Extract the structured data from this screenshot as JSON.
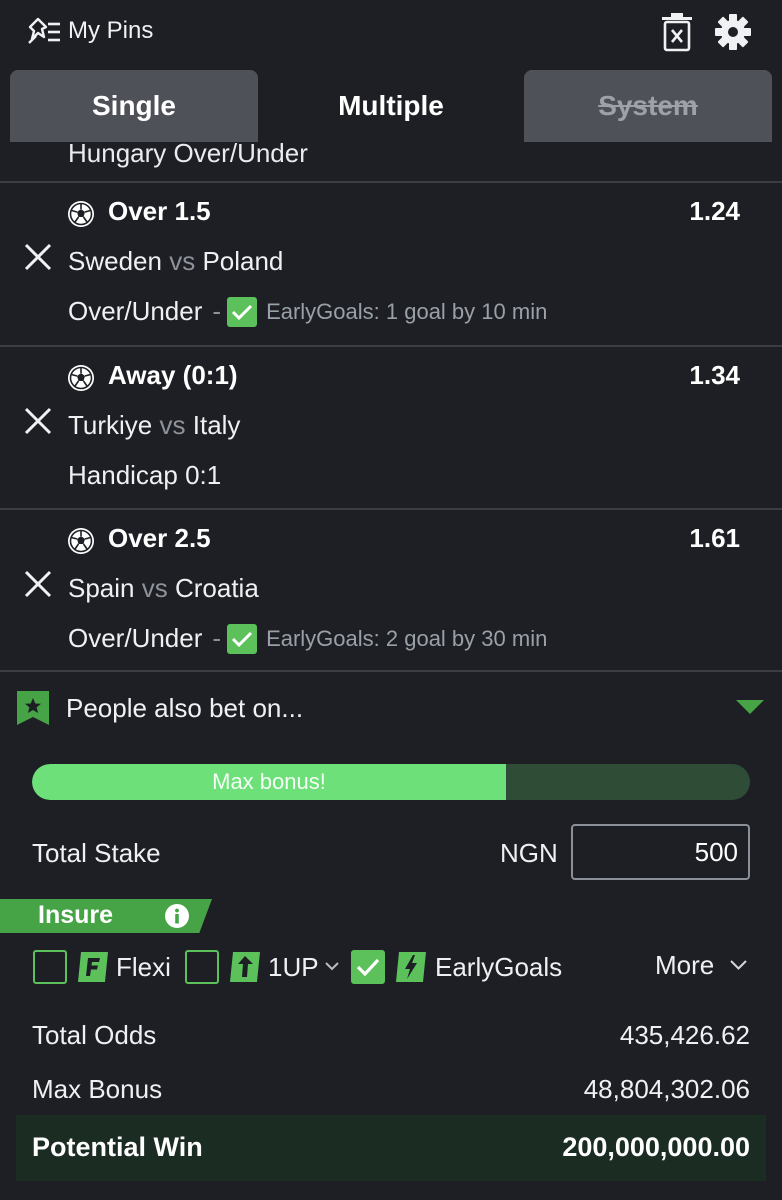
{
  "header": {
    "title": "My Pins",
    "pins_icon": "pin-list-icon",
    "trash_icon": "trash-icon",
    "settings_icon": "gear-icon"
  },
  "tabs": [
    {
      "label": "Single"
    },
    {
      "label": "Multiple",
      "active": true
    },
    {
      "label": "System",
      "disabled": true
    }
  ],
  "cut_row_text": "Hungary Over/Under",
  "bets": [
    {
      "selection": "Over 1.5",
      "odds": "1.24",
      "home": "Sweden",
      "vs": "vs",
      "away": "Poland",
      "market": "Over/Under",
      "separator": "-",
      "early_goals": "EarlyGoals: 1 goal by 10 min"
    },
    {
      "selection": "Away (0:1)",
      "odds": "1.34",
      "home": "Turkiye",
      "vs": "vs",
      "away": "Italy",
      "market": "Handicap 0:1",
      "separator": "",
      "early_goals": ""
    },
    {
      "selection": "Over 2.5",
      "odds": "1.61",
      "home": "Spain",
      "vs": "vs",
      "away": "Croatia",
      "market": "Over/Under",
      "separator": "-",
      "early_goals": "EarlyGoals: 2 goal by 30 min"
    }
  ],
  "people_also_bet": "People also bet on...",
  "bonus_progress": {
    "label": "Max bonus!",
    "fraction": 0.66
  },
  "stake": {
    "label": "Total Stake",
    "currency": "NGN",
    "value": "500"
  },
  "insure": {
    "label": "Insure"
  },
  "options": {
    "flexi": "Flexi",
    "oneup": "1UP",
    "earlygoals": "EarlyGoals",
    "more": "More"
  },
  "totals": {
    "odds_label": "Total Odds",
    "odds_value": "435,426.62",
    "bonus_label": "Max Bonus",
    "bonus_value": "48,804,302.06",
    "win_label": "Potential Win",
    "win_value": "200,000,000.00"
  },
  "colors": {
    "background": "#1d1f24",
    "accent_green": "#5cc15a",
    "progress_fill": "#6ee07a",
    "tab_inactive": "#4f5159",
    "potential_bg": "#1b2c23"
  }
}
